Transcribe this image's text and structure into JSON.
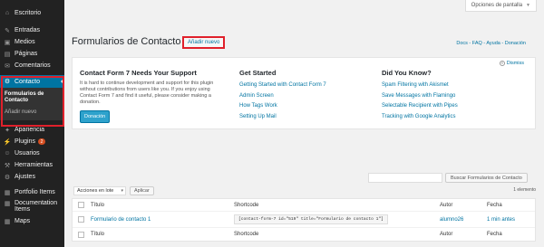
{
  "sidebar": {
    "items": [
      {
        "label": "Escritorio",
        "icon": "dashboard-icon",
        "glyph": "⌂"
      },
      {
        "label": "Entradas",
        "icon": "pushpin-icon",
        "glyph": "✎"
      },
      {
        "label": "Medios",
        "icon": "media-icon",
        "glyph": "▣"
      },
      {
        "label": "Páginas",
        "icon": "pages-icon",
        "glyph": "▤"
      },
      {
        "label": "Comentarios",
        "icon": "comments-icon",
        "glyph": "✉"
      },
      {
        "label": "Contacto",
        "icon": "mail-icon",
        "glyph": "✉"
      },
      {
        "label": "Apariencia",
        "icon": "appearance-icon",
        "glyph": "✦"
      },
      {
        "label": "Plugins",
        "icon": "plugins-icon",
        "glyph": "⚡",
        "badge": "2"
      },
      {
        "label": "Usuarios",
        "icon": "users-icon",
        "glyph": "☺"
      },
      {
        "label": "Herramientas",
        "icon": "tools-icon",
        "glyph": "⚒"
      },
      {
        "label": "Ajustes",
        "icon": "settings-icon",
        "glyph": "⚙"
      },
      {
        "label": "Portfolio Items",
        "icon": "portfolio-icon",
        "glyph": "▦"
      },
      {
        "label": "Documentation Items",
        "icon": "documentation-icon",
        "glyph": "▦"
      },
      {
        "label": "Maps",
        "icon": "maps-icon",
        "glyph": "▦"
      }
    ],
    "submenu": [
      "Formularios de Contacto",
      "Añadir nuevo"
    ]
  },
  "header": {
    "screen_options": "Opciones de pantalla",
    "page_title": "Formularios de Contacto",
    "add_new": "Añadir nuevo",
    "top_links": "Docs - FAQ - Ayuda - Donación"
  },
  "welcome": {
    "dismiss": "Dismiss",
    "col1": {
      "title": "Contact Form 7 Needs Your Support",
      "text": "It is hard to continue development and support for this plugin without contributions from users like you. If you enjoy using Contact Form 7 and find it useful, please consider making a donation.",
      "button": "Donación"
    },
    "col2": {
      "title": "Get Started",
      "links": [
        "Getting Started with Contact Form 7",
        "Admin Screen",
        "How Tags Work",
        "Setting Up Mail"
      ]
    },
    "col3": {
      "title": "Did You Know?",
      "links": [
        "Spam Filtering with Akismet",
        "Save Messages with Flamingo",
        "Selectable Recipient with Pipes",
        "Tracking with Google Analytics"
      ]
    }
  },
  "search": {
    "button": "Buscar Formularios de Contacto"
  },
  "bulk": {
    "selected": "Acciones en lote",
    "apply": "Aplicar",
    "count": "1 elemento"
  },
  "table": {
    "columns": [
      "Título",
      "Shortcode",
      "Autor",
      "Fecha"
    ],
    "rows": [
      {
        "title": "Formulario de contacto 1",
        "shortcode": "[contact-form-7 id=\"519\" title=\"Formulario de contacto 1\"]",
        "author": "alumno26",
        "date": "1 min antes"
      }
    ]
  }
}
